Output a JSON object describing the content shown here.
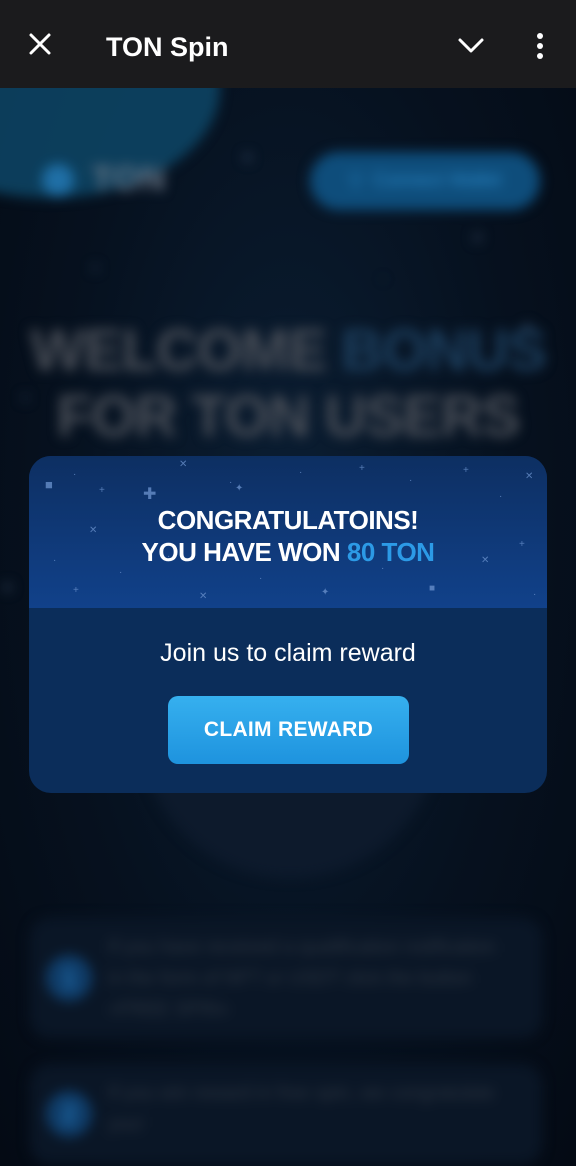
{
  "topbar": {
    "title": "TON Spin",
    "close_icon": "close-icon",
    "collapse_icon": "chevron-down-icon",
    "more_icon": "more-vertical-icon"
  },
  "background": {
    "logo_text": "TON",
    "connect_label": "Connect Wallet",
    "hero_line1_main": "WELCOME ",
    "hero_line1_accent": "BONUS",
    "hero_line2": "FOR TON USERS",
    "steps": [
      {
        "number": "1",
        "text": "If you have received a qualification notification in the form of NFT or USDT click the button «FREE SPIN»"
      },
      {
        "number": "2",
        "text": "If you win reward in free spin, we congratulate you!"
      }
    ]
  },
  "modal": {
    "heading_line1": "CONGRATULATOINS!",
    "heading_line2_prefix": "YOU HAVE WON ",
    "heading_prize": "80 TON",
    "subtitle": "Join us to claim reward",
    "button_label": "CLAIM REWARD"
  },
  "colors": {
    "topbar_bg": "#1b1b1d",
    "modal_body": "#0b2d5a",
    "modal_header": "#11418a",
    "accent": "#2c9ae6",
    "button": "#27a2e8"
  }
}
